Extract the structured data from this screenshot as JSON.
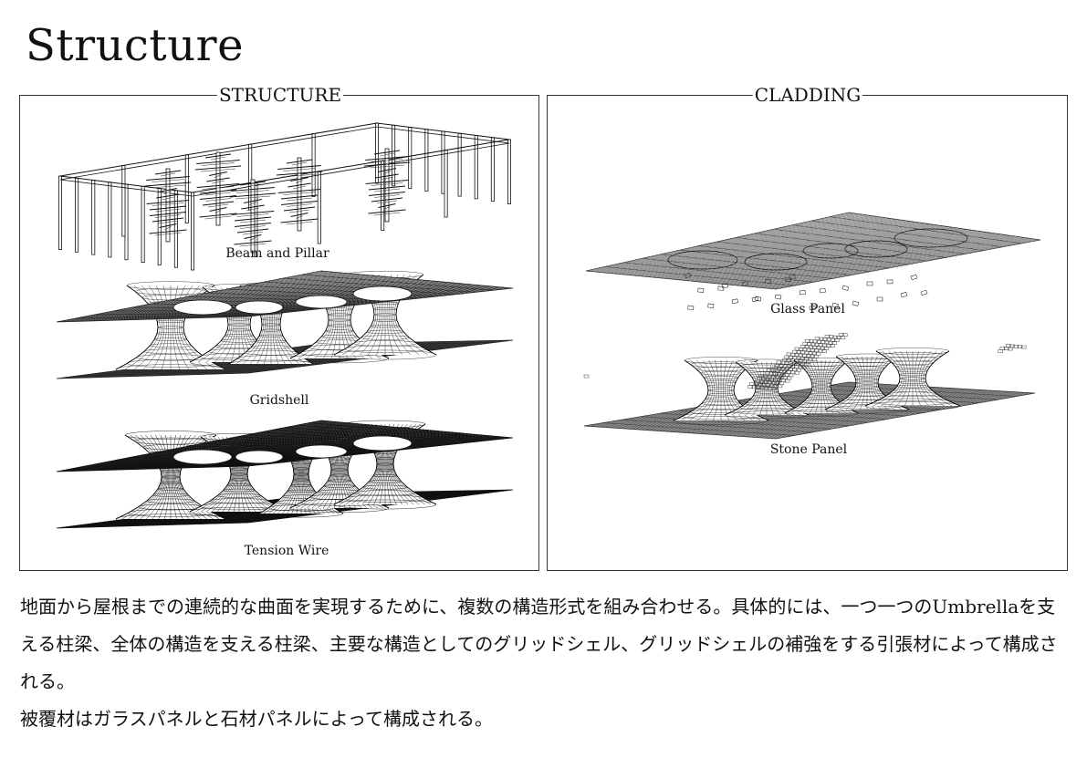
{
  "page": {
    "title": "Structure"
  },
  "structure_panel": {
    "title": "STRUCTURE",
    "items": [
      {
        "caption": "Beam and Pillar"
      },
      {
        "caption": "Gridshell"
      },
      {
        "caption": "Tension Wire"
      }
    ]
  },
  "cladding_panel": {
    "title": "CLADDING",
    "items": [
      {
        "caption": "Glass Panel"
      },
      {
        "caption": "Stone Panel"
      }
    ]
  },
  "description": {
    "paragraph1": "地面から屋根までの連続的な曲面を実現するために、複数の構造形式を組み合わせる。具体的には、一つ一つのUmbrellaを支える柱梁、全体の構造を支える柱梁、主要な構造としてのグリッドシェル、グリッドシェルの補強をする引張材によって構成される。",
    "paragraph2": "被覆材はガラスパネルと石材パネルによって構成される。"
  }
}
